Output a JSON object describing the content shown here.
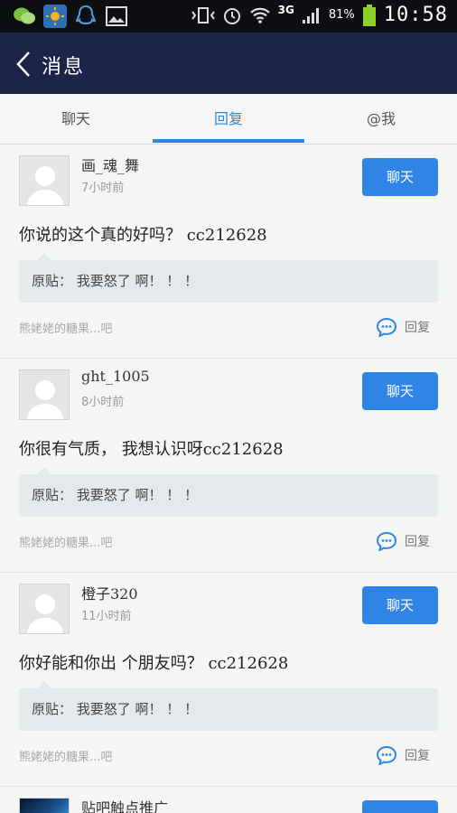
{
  "status_bar": {
    "network": "3G",
    "battery": "81%",
    "time": "10:58"
  },
  "header": {
    "title": "消息"
  },
  "tabs": [
    {
      "label": "聊天",
      "active": false
    },
    {
      "label": "回复",
      "active": true
    },
    {
      "label": "@我",
      "active": false
    }
  ],
  "items": [
    {
      "user": "画_魂_舞",
      "time": "7小时前",
      "chat_label": "聊天",
      "message": "你说的这个真的好吗？ cc212628",
      "quote": "原贴： 我要怒了 啊！ ！ ！",
      "forum": "熊姥姥的糖果...吧",
      "reply_label": "回复"
    },
    {
      "user": "ght_1005",
      "time": "8小时前",
      "chat_label": "聊天",
      "message": "你很有气质， 我想认识呀cc212628",
      "quote": "原贴： 我要怒了 啊！ ！ ！",
      "forum": "熊姥姥的糖果...吧",
      "reply_label": "回复"
    },
    {
      "user": "橙子320",
      "time": "11小时前",
      "chat_label": "聊天",
      "message": "你好能和你出 个朋友吗？ cc212628",
      "quote": "原贴： 我要怒了 啊！ ！ ！",
      "forum": "熊姥姥的糖果...吧",
      "reply_label": "回复"
    }
  ],
  "partial_item": {
    "user": "贴吧触点推广"
  },
  "colors": {
    "accent": "#2f84e6",
    "header_bg": "#1c2548",
    "battery": "#8ed02a"
  }
}
